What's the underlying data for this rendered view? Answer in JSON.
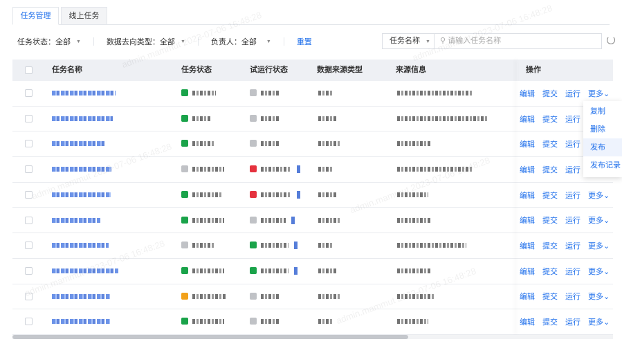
{
  "tabs": [
    {
      "label": "任务管理",
      "active": true
    },
    {
      "label": "线上任务",
      "active": false
    }
  ],
  "filters": {
    "status": "任务状态：全部",
    "dest_type": "数据去向类型：全部",
    "owner": "负责人：全部",
    "reset": "重置"
  },
  "search": {
    "field": "任务名称",
    "placeholder": "请输入任务名称"
  },
  "table": {
    "headers": [
      "任务名称",
      "任务状态",
      "试运行状态",
      "数据来源类型",
      "来源信息",
      "操作"
    ],
    "actions": [
      "编辑",
      "提交",
      "运行",
      "更多"
    ],
    "rows": [
      {
        "status_color": "#1aa34a",
        "trial_color": "#c0c2c6",
        "trial_link": false
      },
      {
        "status_color": "#1aa34a",
        "trial_color": "#c0c2c6",
        "trial_link": false
      },
      {
        "status_color": "#1aa34a",
        "trial_color": "#c0c2c6",
        "trial_link": false
      },
      {
        "status_color": "#c0c2c6",
        "trial_color": "#e5323e",
        "trial_link": true
      },
      {
        "status_color": "#1aa34a",
        "trial_color": "#e5323e",
        "trial_link": true
      },
      {
        "status_color": "#1aa34a",
        "trial_color": "#c0c2c6",
        "trial_link": true
      },
      {
        "status_color": "#c0c2c6",
        "trial_color": "#1aa34a",
        "trial_link": true
      },
      {
        "status_color": "#1aa34a",
        "trial_color": "#1aa34a",
        "trial_link": true
      },
      {
        "status_color": "#f2a11a",
        "trial_color": "#c0c2c6",
        "trial_link": false
      },
      {
        "status_color": "#1aa34a",
        "trial_color": "#c0c2c6",
        "trial_link": false
      }
    ]
  },
  "more_menu": {
    "items": [
      "复制",
      "删除",
      "发布",
      "发布记录"
    ],
    "hovered": "发布"
  },
  "watermark": "admin.mammut 2023-07-06 16:48:28"
}
